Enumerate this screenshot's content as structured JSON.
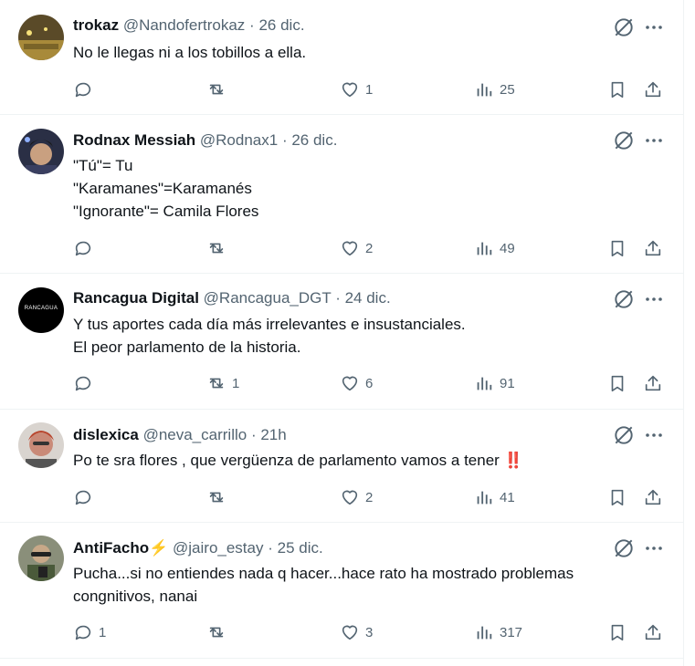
{
  "tweets": [
    {
      "name": "trokaz",
      "handle": "@Nandofertrokaz",
      "dot": "·",
      "date": "26 dic.",
      "lines": [
        "No le llegas ni a los tobillos a ella."
      ],
      "replies": "",
      "retweets": "",
      "likes": "1",
      "views": "25"
    },
    {
      "name": "Rodnax Messiah",
      "handle": "@Rodnax1",
      "dot": "·",
      "date": "26 dic.",
      "lines": [
        "\"Tú\"= Tu",
        "\"Karamanes\"=Karamanés",
        "\"Ignorante\"= Camila Flores"
      ],
      "replies": "",
      "retweets": "",
      "likes": "2",
      "views": "49"
    },
    {
      "name": "Rancagua Digital",
      "handle": "@Rancagua_DGT",
      "dot": "·",
      "date": "24 dic.",
      "avatar_text": "RANCAGUA",
      "lines": [
        "Y tus aportes cada día más irrelevantes e insustanciales.",
        "El peor parlamento de la historia."
      ],
      "replies": "",
      "retweets": "1",
      "likes": "6",
      "views": "91"
    },
    {
      "name": "dislexica",
      "handle": "@neva_carrillo",
      "dot": "·",
      "date": "21h",
      "lines": [
        "Po te sra flores , que vergüenza de parlamento vamos a tener"
      ],
      "emoji": "‼️",
      "replies": "",
      "retweets": "",
      "likes": "2",
      "views": "41"
    },
    {
      "name": "AntiFacho",
      "name_emoji": "⚡",
      "handle": "@jairo_estay",
      "dot": "·",
      "date": "25 dic.",
      "lines": [
        "Pucha...si no entiendes nada q hacer...hace rato ha mostrado problemas",
        "congnitivos, nanai"
      ],
      "replies": "1",
      "retweets": "",
      "likes": "3",
      "views": "317"
    }
  ],
  "icons": {
    "avatar": "avatar",
    "grok": "grok-icon",
    "more": "more-icon",
    "reply": "reply-icon",
    "retweet": "retweet-icon",
    "like": "like-icon",
    "views": "views-icon",
    "bookmark": "bookmark-icon",
    "share": "share-icon"
  },
  "colors": {
    "text": "#0f1419",
    "secondary": "#536471",
    "divider": "#eff3f4",
    "emoji_red": "#d1202f"
  }
}
